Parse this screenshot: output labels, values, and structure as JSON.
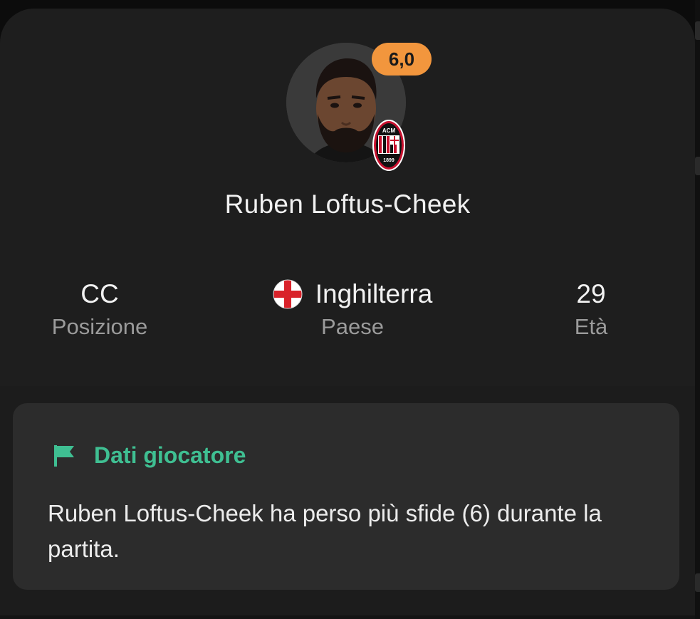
{
  "player": {
    "name": "Ruben Loftus-Cheek",
    "rating": "6,0",
    "club_badge": {
      "icon": "ac-milan-crest-icon",
      "text": "ACM",
      "year": "1899"
    }
  },
  "stats": [
    {
      "value": "CC",
      "label": "Posizione"
    },
    {
      "value": "Inghilterra",
      "label": "Paese",
      "icon": "england-flag-icon"
    },
    {
      "value": "29",
      "label": "Età"
    }
  ],
  "insight": {
    "title": "Dati giocatore",
    "icon": "flag-icon",
    "text": "Ruben Loftus-Cheek ha perso più sfide (6) durante la partita."
  },
  "colors": {
    "rating_badge": "#f2963d",
    "accent": "#3fbf92",
    "background": "#1e1e1e",
    "card": "#2c2c2c"
  }
}
